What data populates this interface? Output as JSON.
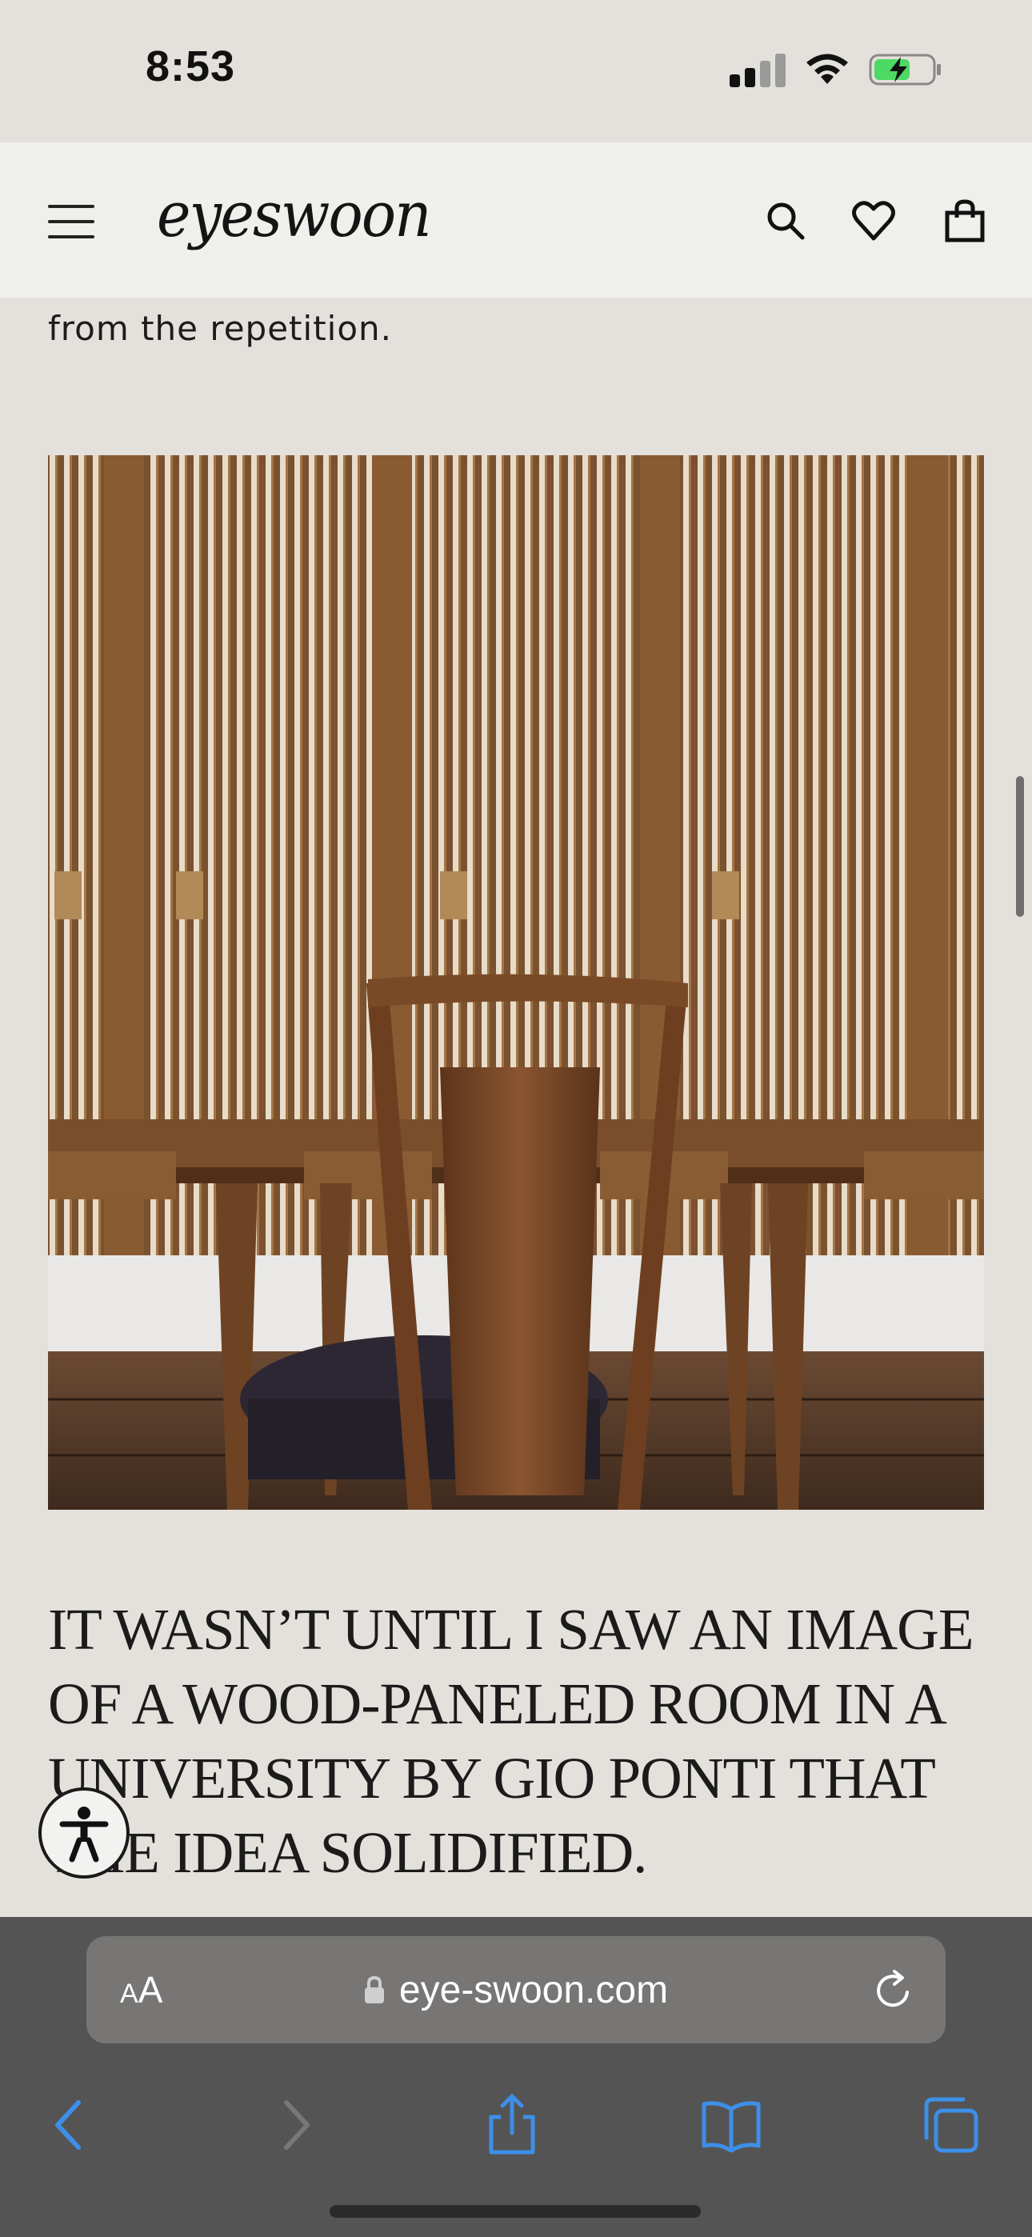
{
  "status_bar": {
    "time": "8:53"
  },
  "header": {
    "logo": "eyeswoon",
    "icons": [
      "menu-icon",
      "search-icon",
      "heart-icon",
      "shopping-bag-icon"
    ]
  },
  "article": {
    "intro_tail": "from the repetition.",
    "image_alt": "Wood-paneled room with fluted wooden doors, a long wooden table and a wooden chair with leather seat",
    "heading": "IT WASN’T UNTIL I SAW AN IMAGE OF A WOOD-PANELED ROOM IN A UNIVERSITY BY GIO PONTI THAT THE IDEA SOLIDIFIED."
  },
  "browser": {
    "aa_small": "A",
    "aa_large": "A",
    "url": "eye-swoon.com",
    "toolbar_icons": [
      "back-icon",
      "forward-icon",
      "share-icon",
      "bookmarks-icon",
      "tabs-icon"
    ]
  },
  "colors": {
    "page_bg": "#e4e1dc",
    "header_bg": "#efefec",
    "safari_bg": "#545454",
    "link_blue": "#3d8fe8"
  }
}
